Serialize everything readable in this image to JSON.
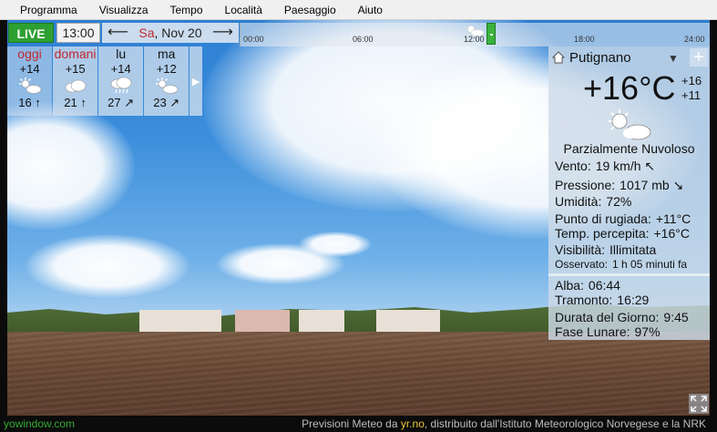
{
  "menu": {
    "items": [
      "Programma",
      "Visualizza",
      "Tempo",
      "Località",
      "Paesaggio",
      "Aiuto"
    ]
  },
  "controls": {
    "live_label": "LIVE",
    "current_time": "13:00",
    "date_weekday": "Sa",
    "date_rest": ", Nov 20",
    "back_arrow": "⟵",
    "forward_arrow": "⟶"
  },
  "timeline": {
    "ticks": [
      "00:00",
      "06:00",
      "12:00",
      "18:00",
      "24:00"
    ]
  },
  "forecast": {
    "days": [
      {
        "name": "oggi",
        "temp": "+14",
        "icon": "partly-cloudy-icon",
        "wind": "16 ↑"
      },
      {
        "name": "domani",
        "temp": "+15",
        "icon": "cloud-icon",
        "wind": "21 ↑"
      },
      {
        "name": "lu",
        "temp": "+14",
        "icon": "rain-cloud-icon",
        "wind": "27 ↗"
      },
      {
        "name": "ma",
        "temp": "+12",
        "icon": "partly-cloudy-icon",
        "wind": "23 ↗"
      }
    ],
    "more_arrow": "▶"
  },
  "panel": {
    "location": "Putignano",
    "dropdown_arrow": "▼",
    "add_button": "+",
    "temperature": "+16°C",
    "high": "+16",
    "low": "+11",
    "description": "Parzialmente Nuvoloso",
    "wind_label": "Vento:",
    "wind_value": "19 km/h ↖",
    "pressure_label": "Pressione:",
    "pressure_value": "1017 mb ↘",
    "humidity_label": "Umidità:",
    "humidity_value": "72%",
    "dewpoint_label": "Punto di rugiada:",
    "dewpoint_value": "+11°C",
    "feels_label": "Temp. percepita:",
    "feels_value": "+16°C",
    "visibility_label": "Visibilità:",
    "visibility_value": "Illimitata",
    "observed_label": "Osservato:",
    "observed_value": "1 h 05 minuti fa",
    "sunrise_label": "Alba:",
    "sunrise_value": "06:44",
    "sunset_label": "Tramonto:",
    "sunset_value": "16:29",
    "daylength_label": "Durata del Giorno:",
    "daylength_value": "9:45",
    "moon_label": "Fase Lunare:",
    "moon_value": "97%"
  },
  "statusbar": {
    "brand": "yowindow.com",
    "credits_before": "Previsioni Meteo da ",
    "credits_link": "yr.no",
    "credits_after": ", distribuito dall'Istituto Meteorologico Norvegese e la NRK"
  },
  "colors": {
    "live_green": "#2ea032",
    "accent_red": "#c0272d",
    "brand_green": "#33aa33",
    "link_yellow": "#e8c337"
  }
}
